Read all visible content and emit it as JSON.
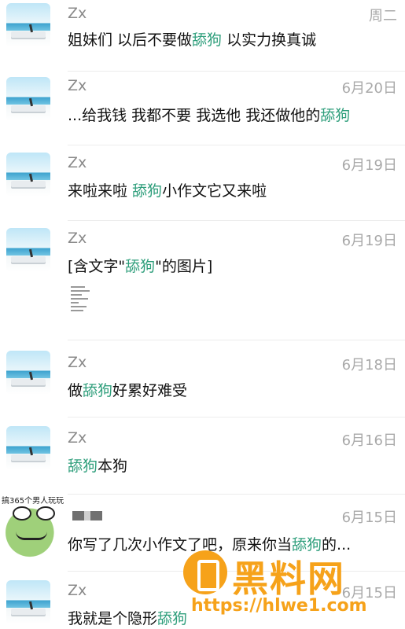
{
  "conversations": [
    {
      "name": "Zx",
      "date": "周二",
      "message": [
        {
          "t": "姐妹们 以后不要做"
        },
        {
          "t": "舔狗",
          "hl": true
        },
        {
          "t": " 以实力换真诚"
        }
      ]
    },
    {
      "name": "Zx",
      "date": "6月20日",
      "message": [
        {
          "t": "...给我钱 我都不要 我选他 我还做他的"
        },
        {
          "t": "舔狗",
          "hl": true
        }
      ]
    },
    {
      "name": "Zx",
      "date": "6月19日",
      "message": [
        {
          "t": "来啦来啦 "
        },
        {
          "t": "舔狗",
          "hl": true
        },
        {
          "t": "小作文它又来啦"
        }
      ]
    },
    {
      "name": "Zx",
      "date": "6月19日",
      "message": [
        {
          "t": "[含文字\""
        },
        {
          "t": "舔狗",
          "hl": true
        },
        {
          "t": "\"的图片]"
        }
      ]
    },
    {
      "name": "Zx",
      "date": "6月18日",
      "message": [
        {
          "t": "做"
        },
        {
          "t": "舔狗",
          "hl": true
        },
        {
          "t": "好累好难受"
        }
      ]
    },
    {
      "name": "Zx",
      "date": "6月16日",
      "message": [
        {
          "t": "舔狗",
          "hl": true
        },
        {
          "t": "本狗"
        }
      ]
    },
    {
      "name": "",
      "date": "6月15日",
      "message": [
        {
          "t": "你写了几次小作文了吧，原来你当"
        },
        {
          "t": "舔狗",
          "hl": true
        },
        {
          "t": "的..."
        }
      ]
    },
    {
      "name": "Zx",
      "date": "6月15日",
      "message": [
        {
          "t": "我就是个隐形"
        },
        {
          "t": "舔狗",
          "hl": true
        }
      ]
    }
  ],
  "sticker": {
    "caption": "搞365个男人玩玩"
  },
  "watermark": {
    "title": "黑料网",
    "url": "https://hlwe1.com"
  },
  "colors": {
    "highlight": "#2e9e7b",
    "watermark": "#f6a21a"
  }
}
